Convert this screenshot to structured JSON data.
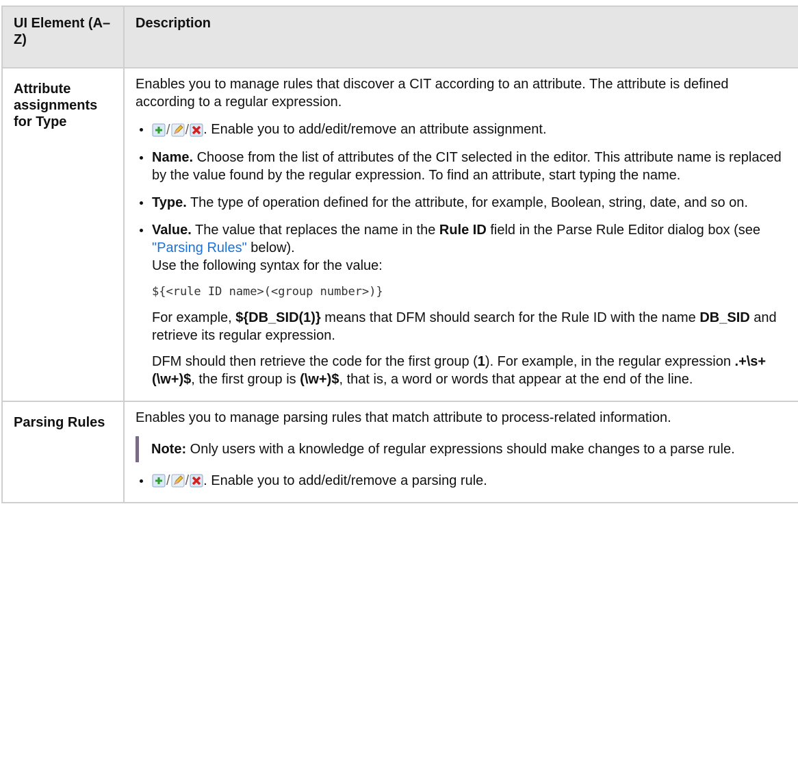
{
  "header": {
    "col1": "UI Element (A–Z)",
    "col2": "Description"
  },
  "rows": [
    {
      "name": "Attribute assignments for Type",
      "intro": "Enables you to manage rules that discover a CIT according to an attribute. The attribute is defined according to a regular expression.",
      "icons_text": ". Enable you to add/edit/remove an attribute assignment.",
      "name_label": "Name.",
      "name_text": " Choose from the list of attributes of the CIT selected in the editor. This attribute name is replaced by the value found by the regular expression. To find an attribute, start typing the name.",
      "type_label": "Type.",
      "type_text": " The type of operation defined for the attribute, for example, Boolean, string, date, and so on.",
      "value_label": "Value.",
      "value_text_1": " The value that replaces the name in the ",
      "value_bold": "Rule ID",
      "value_text_2": " field in the Parse Rule Editor dialog box (see ",
      "value_link": "\"Parsing Rules\"",
      "value_text_3": " below).",
      "syntax_intro": "Use the following syntax for the value:",
      "syntax_code": "${<rule ID name>(<group number>)}",
      "example_1": "For example, ",
      "example_bold_1": "${DB_SID(1)}",
      "example_2": " means that DFM should search for the Rule ID with the name ",
      "example_bold_2": "DB_SID",
      "example_3": " and retrieve its regular expression.",
      "dfm_1": "DFM should then retrieve the code for the first group (",
      "dfm_bold_1": "1",
      "dfm_2": "). For example, in the regular expression ",
      "dfm_bold_2": ".+\\s+(\\w+)$",
      "dfm_3": ", the first group is ",
      "dfm_bold_3": "(\\w+)$",
      "dfm_4": ", that is, a word or words that appear at the end of the line."
    },
    {
      "name": "Parsing Rules",
      "intro": "Enables you to manage parsing rules that match attribute to process-related information.",
      "note_label": "Note:",
      "note_text": "  Only users with a knowledge of regular expressions should make changes to a parse rule.",
      "icons_text": ". Enable you to add/edit/remove a parsing rule."
    }
  ],
  "icons": [
    "add-icon",
    "edit-icon",
    "remove-icon"
  ],
  "colors": {
    "header_bg": "#e5e5e5",
    "border": "#cfcfcf",
    "link": "#1a73d9",
    "note_bar": "#7a6b85"
  }
}
